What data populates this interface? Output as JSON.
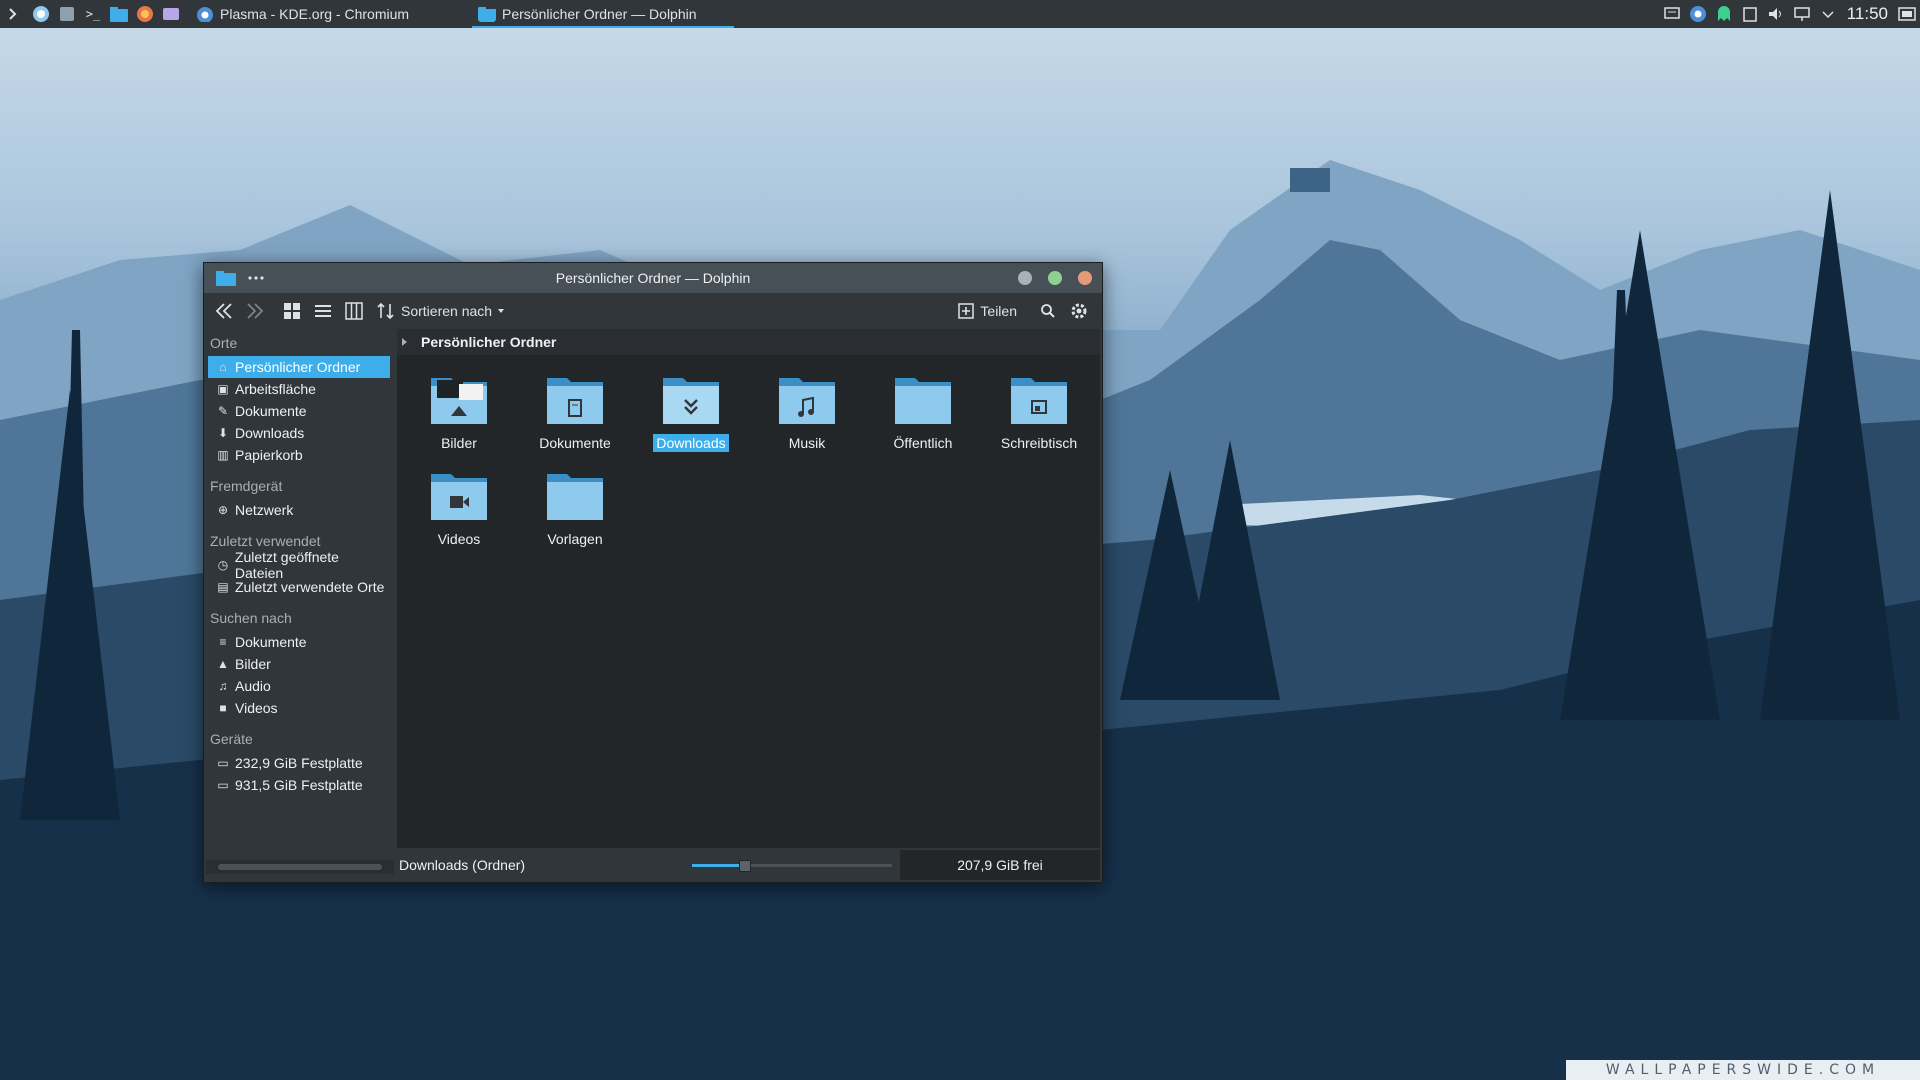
{
  "panel": {
    "tasks": [
      {
        "label": "Plasma - KDE.org - Chromium",
        "icon": "chromium-icon"
      },
      {
        "label": "Persönlicher Ordner — Dolphin",
        "icon": "folder-icon"
      }
    ],
    "clock": "11:50"
  },
  "window": {
    "title": "Persönlicher Ordner — Dolphin",
    "toolbar": {
      "sort_label": "Sortieren nach",
      "share_label": "Teilen"
    },
    "breadcrumb": "Persönlicher Ordner",
    "sidebar": {
      "groups": [
        {
          "title": "Orte",
          "items": [
            {
              "label": "Persönlicher Ordner",
              "icon": "home-icon"
            },
            {
              "label": "Arbeitsfläche",
              "icon": "desktop-icon"
            },
            {
              "label": "Dokumente",
              "icon": "documents-icon"
            },
            {
              "label": "Downloads",
              "icon": "download-icon"
            },
            {
              "label": "Papierkorb",
              "icon": "trash-icon"
            }
          ]
        },
        {
          "title": "Fremdgerät",
          "items": [
            {
              "label": "Netzwerk",
              "icon": "network-icon"
            }
          ]
        },
        {
          "title": "Zuletzt verwendet",
          "items": [
            {
              "label": "Zuletzt geöffnete Dateien",
              "icon": "clock-icon"
            },
            {
              "label": "Zuletzt verwendete Orte",
              "icon": "recent-places-icon"
            }
          ]
        },
        {
          "title": "Suchen nach",
          "items": [
            {
              "label": "Dokumente",
              "icon": "text-icon"
            },
            {
              "label": "Bilder",
              "icon": "image-icon"
            },
            {
              "label": "Audio",
              "icon": "music-icon"
            },
            {
              "label": "Videos",
              "icon": "video-icon"
            }
          ]
        },
        {
          "title": "Geräte",
          "items": [
            {
              "label": "232,9 GiB Festplatte",
              "icon": "drive-icon"
            },
            {
              "label": "931,5 GiB Festplatte",
              "icon": "drive-icon"
            }
          ]
        }
      ]
    },
    "folders": [
      {
        "label": "Bilder",
        "icon": "pictures-folder-icon"
      },
      {
        "label": "Dokumente",
        "icon": "documents-folder-icon"
      },
      {
        "label": "Downloads",
        "icon": "downloads-folder-icon"
      },
      {
        "label": "Musik",
        "icon": "music-folder-icon"
      },
      {
        "label": "Öffentlich",
        "icon": "public-folder-icon"
      },
      {
        "label": "Schreibtisch",
        "icon": "desktop-folder-icon"
      },
      {
        "label": "Videos",
        "icon": "videos-folder-icon"
      },
      {
        "label": "Vorlagen",
        "icon": "templates-folder-icon"
      }
    ],
    "status": {
      "selection": "Downloads (Ordner)",
      "zoom_fraction": 0.26,
      "free": "207,9 GiB frei"
    }
  },
  "watermark": "WALLPAPERSWIDE.COM",
  "colors": {
    "accent": "#3daee9",
    "window_bg": "#31363b",
    "view_bg": "#232629",
    "folder": "#8ec9ee",
    "folder_dark": "#3b8fc7"
  }
}
